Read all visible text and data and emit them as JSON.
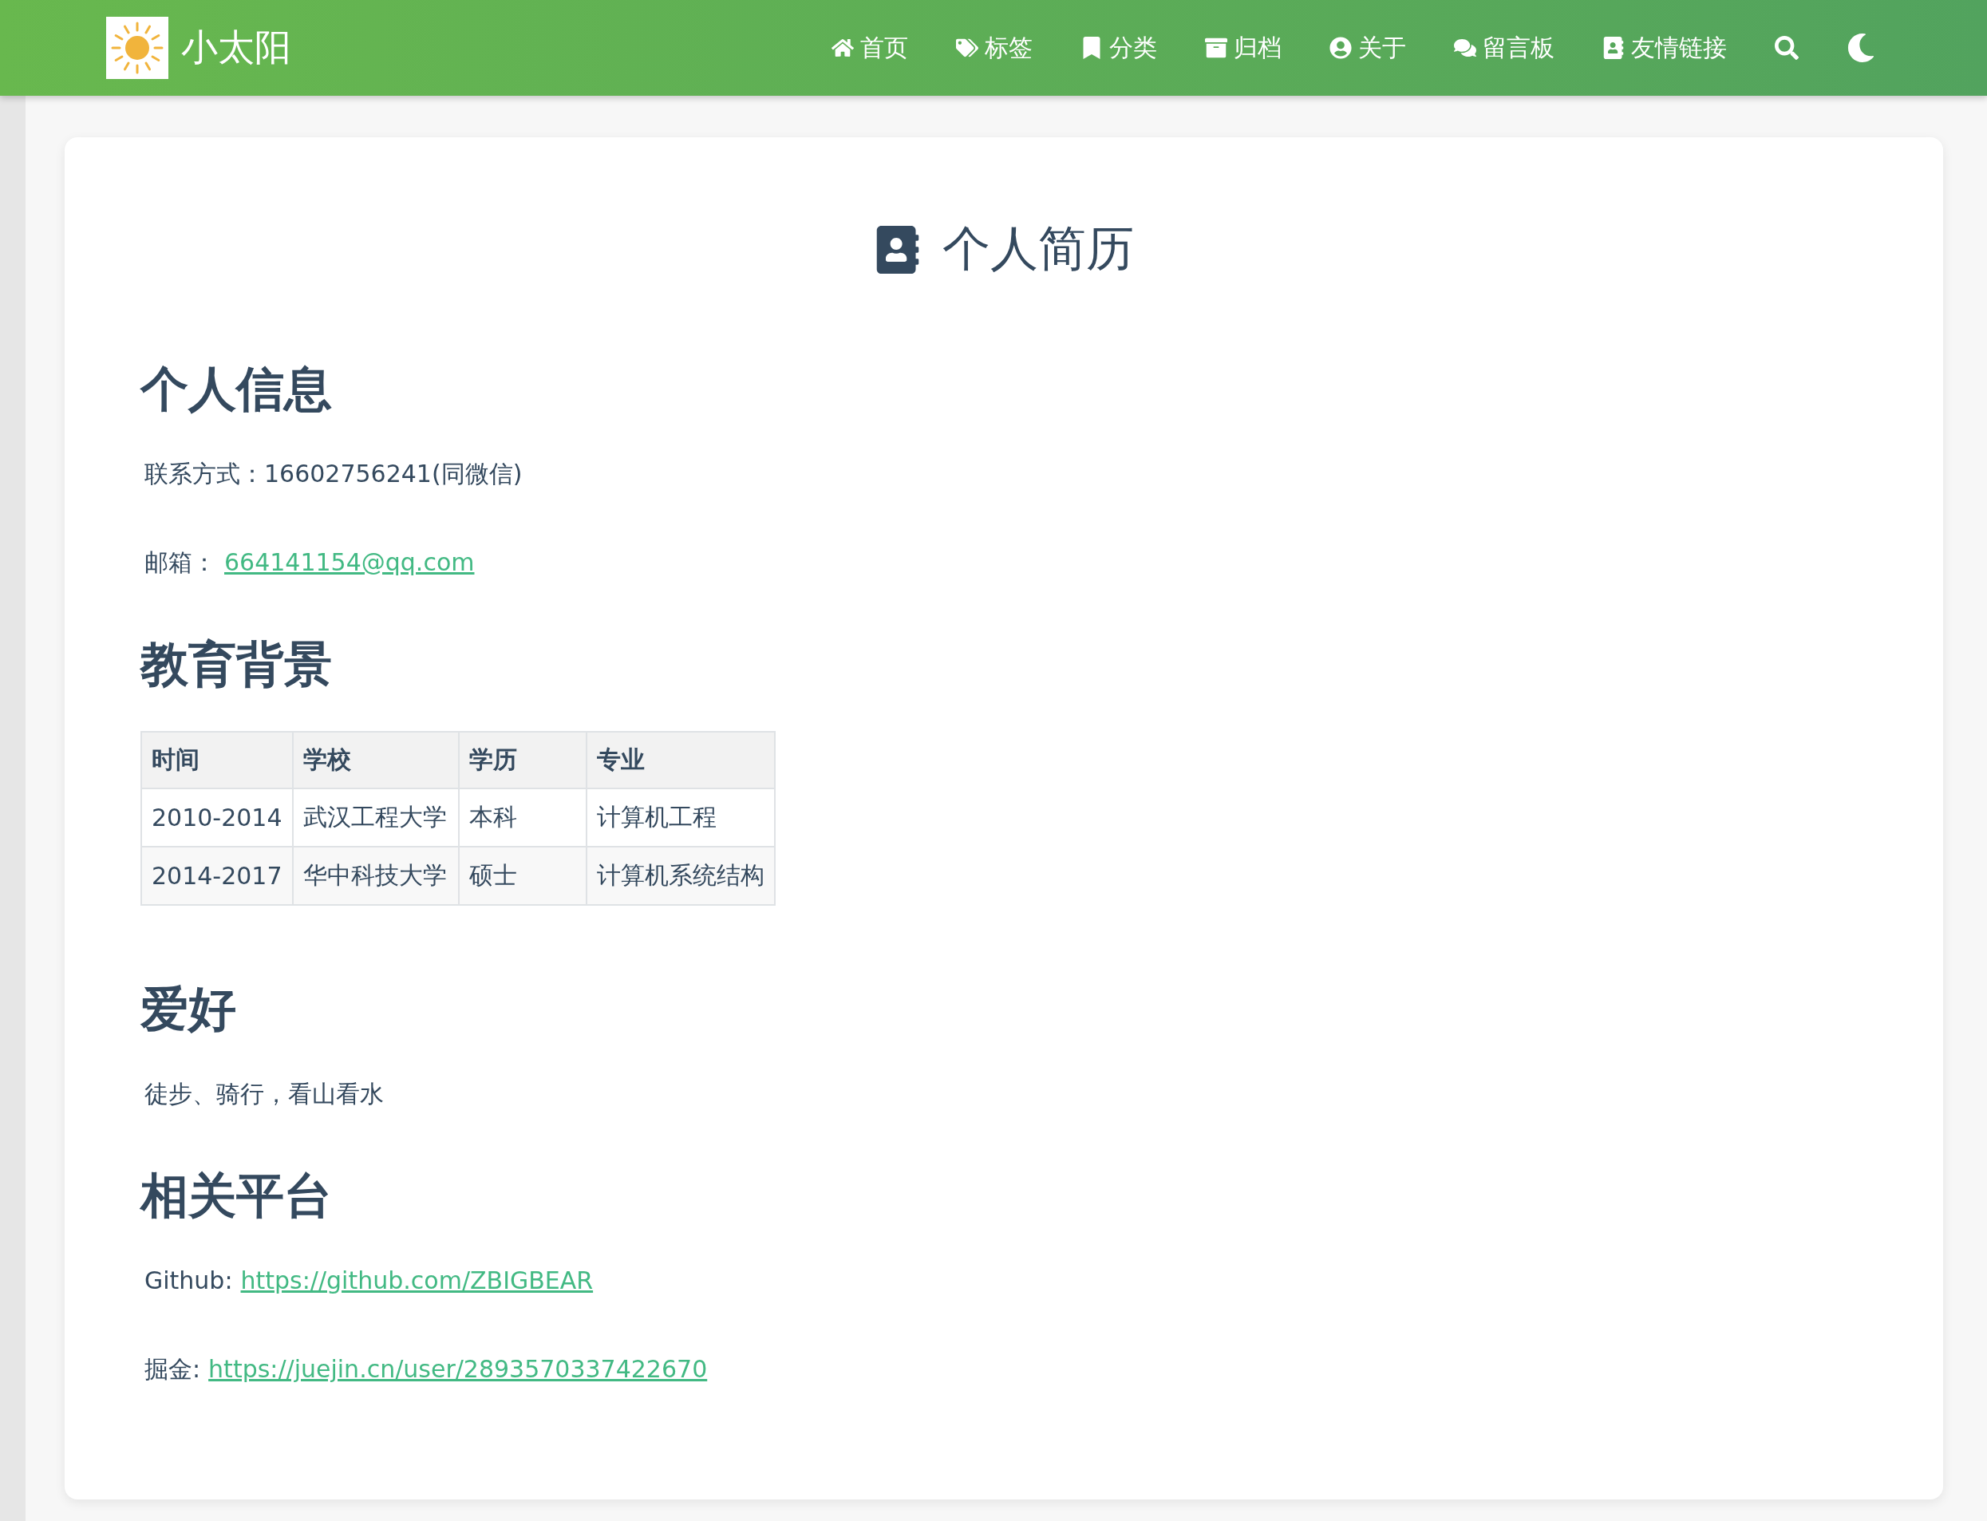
{
  "header": {
    "site_title": "小太阳",
    "nav": [
      {
        "label": "首页"
      },
      {
        "label": "标签"
      },
      {
        "label": "分类"
      },
      {
        "label": "归档"
      },
      {
        "label": "关于"
      },
      {
        "label": "留言板"
      },
      {
        "label": "友情链接"
      }
    ]
  },
  "page": {
    "title": "个人简历",
    "sections": [
      {
        "heading": "个人信息",
        "kind": "lines",
        "lines": [
          {
            "label": "联系方式：16602756241(同微信)"
          },
          {
            "label": "邮箱：",
            "link": "664141154@qq.com"
          }
        ]
      },
      {
        "heading": "教育背景",
        "kind": "table",
        "columns": [
          "时间",
          "学校",
          "学历",
          "专业"
        ],
        "rows": [
          [
            "2010-2014",
            "武汉工程大学",
            "本科",
            "计算机工程"
          ],
          [
            "2014-2017",
            "华中科技大学",
            "硕士",
            "计算机系统结构"
          ]
        ]
      },
      {
        "heading": "爱好",
        "kind": "lines",
        "lines": [
          {
            "label": "徒步、骑行，看山看水"
          }
        ]
      },
      {
        "heading": "相关平台",
        "kind": "lines",
        "lines": [
          {
            "label": "Github:",
            "link": "https://github.com/ZBIGBEAR"
          },
          {
            "label": "掘金:",
            "link": "https://juejin.cn/user/2893570337422670"
          }
        ]
      }
    ]
  }
}
